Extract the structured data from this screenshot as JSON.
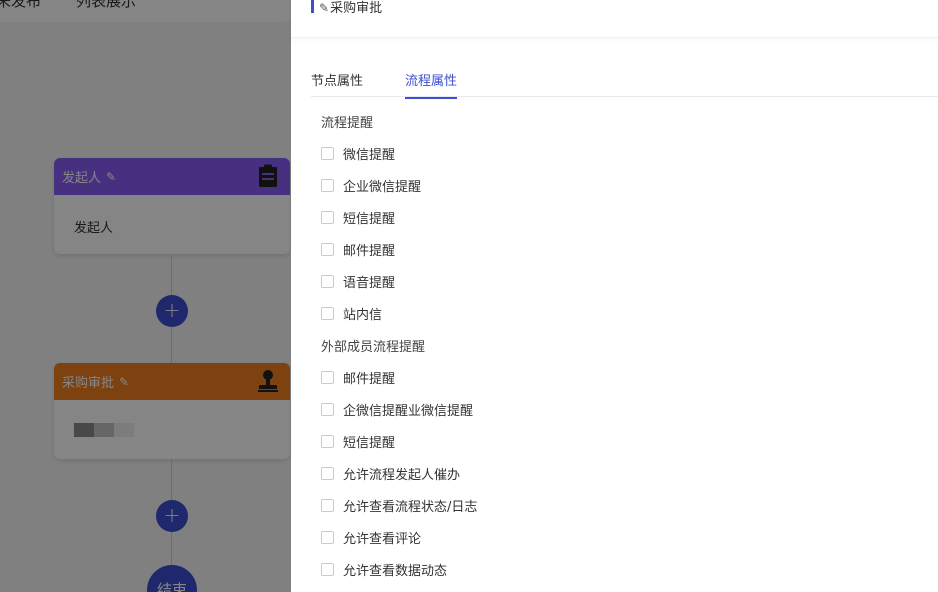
{
  "background": {
    "top_tabs": [
      "未发布",
      "列表展示"
    ],
    "nodes": {
      "initiator": {
        "title": "发起人",
        "body": "发起人",
        "color": "#8b5cf6",
        "icon": "clipboard-icon"
      },
      "purchase": {
        "title": "采购审批",
        "body": "",
        "color": "#f07f20",
        "icon": "stamp-icon"
      }
    },
    "add_button_label": "+",
    "end_label": "结束"
  },
  "drawer": {
    "title": "采购审批",
    "tabs": [
      {
        "label": "节点属性",
        "active": false
      },
      {
        "label": "流程属性",
        "active": true
      }
    ],
    "sections": [
      {
        "label": "流程提醒",
        "items": [
          "微信提醒",
          "企业微信提醒",
          "短信提醒",
          "邮件提醒",
          "语音提醒",
          "站内信"
        ]
      },
      {
        "label": "外部成员流程提醒",
        "items": [
          "邮件提醒",
          "企微信提醒业微信提醒",
          "短信提醒",
          "允许流程发起人催办",
          "允许查看流程状态/日志",
          "允许查看评论",
          "允许查看数据动态"
        ]
      }
    ],
    "accent_color": "#3d4ed1"
  }
}
